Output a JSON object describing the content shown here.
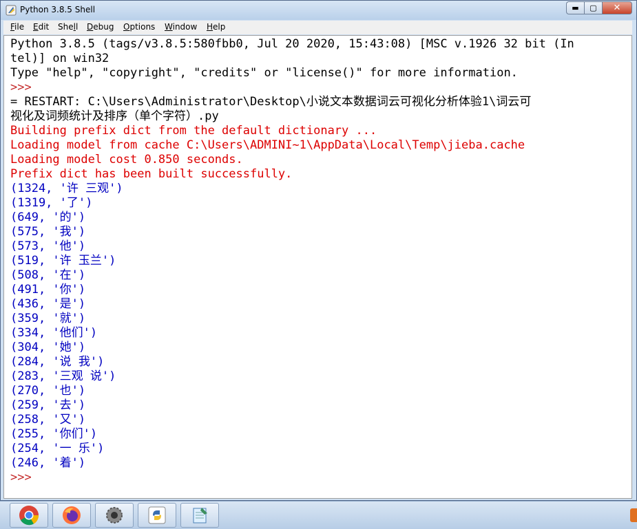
{
  "window": {
    "title": "Python 3.8.5 Shell"
  },
  "title_buttons": {
    "minimize": "▬",
    "maximize": "▢",
    "close": "✕"
  },
  "menu": {
    "file": {
      "u": "F",
      "rest": "ile"
    },
    "edit": {
      "u": "E",
      "rest": "dit"
    },
    "shell": {
      "pre": "She",
      "u": "l",
      "rest": "l"
    },
    "debug": {
      "u": "D",
      "rest": "ebug"
    },
    "options": {
      "u": "O",
      "rest": "ptions"
    },
    "window": {
      "u": "W",
      "rest": "indow"
    },
    "help": {
      "u": "H",
      "rest": "elp"
    }
  },
  "shell": {
    "banner1": "Python 3.8.5 (tags/v3.8.5:580fbb0, Jul 20 2020, 15:43:08) [MSC v.1926 32 bit (In",
    "banner2": "tel)] on win32",
    "banner3": "Type \"help\", \"copyright\", \"credits\" or \"license()\" for more information.",
    "prompt": ">>>",
    "restart1": "= RESTART: C:\\Users\\Administrator\\Desktop\\小说文本数据词云可视化分析体验1\\词云可",
    "restart2": "视化及词频统计及排序（单个字符）.py",
    "log1": "Building prefix dict from the default dictionary ...",
    "log2": "Loading model from cache C:\\Users\\ADMINI~1\\AppData\\Local\\Temp\\jieba.cache",
    "log3": "Loading model cost 0.850 seconds.",
    "log4": "Prefix dict has been built successfully.",
    "results": [
      "(1324, '许 三观')",
      "(1319, '了')",
      "(649, '的')",
      "(575, '我')",
      "(573, '他')",
      "(519, '许 玉兰')",
      "(508, '在')",
      "(491, '你')",
      "(436, '是')",
      "(359, '就')",
      "(334, '他们')",
      "(304, '她')",
      "(284, '说 我')",
      "(283, '三观 说')",
      "(270, '也')",
      "(259, '去')",
      "(258, '又')",
      "(255, '你们')",
      "(254, '一 乐')",
      "(246, '着')"
    ],
    "final_prompt": ">>>"
  },
  "taskbar": {
    "icons": [
      "chrome-icon",
      "firefox-icon",
      "settings-gear-icon",
      "python-idle-icon",
      "notepad-icon"
    ]
  },
  "colors": {
    "output_blue": "#0000c0",
    "stderr_red": "#dd0000",
    "prompt_red": "#c42a2a"
  }
}
